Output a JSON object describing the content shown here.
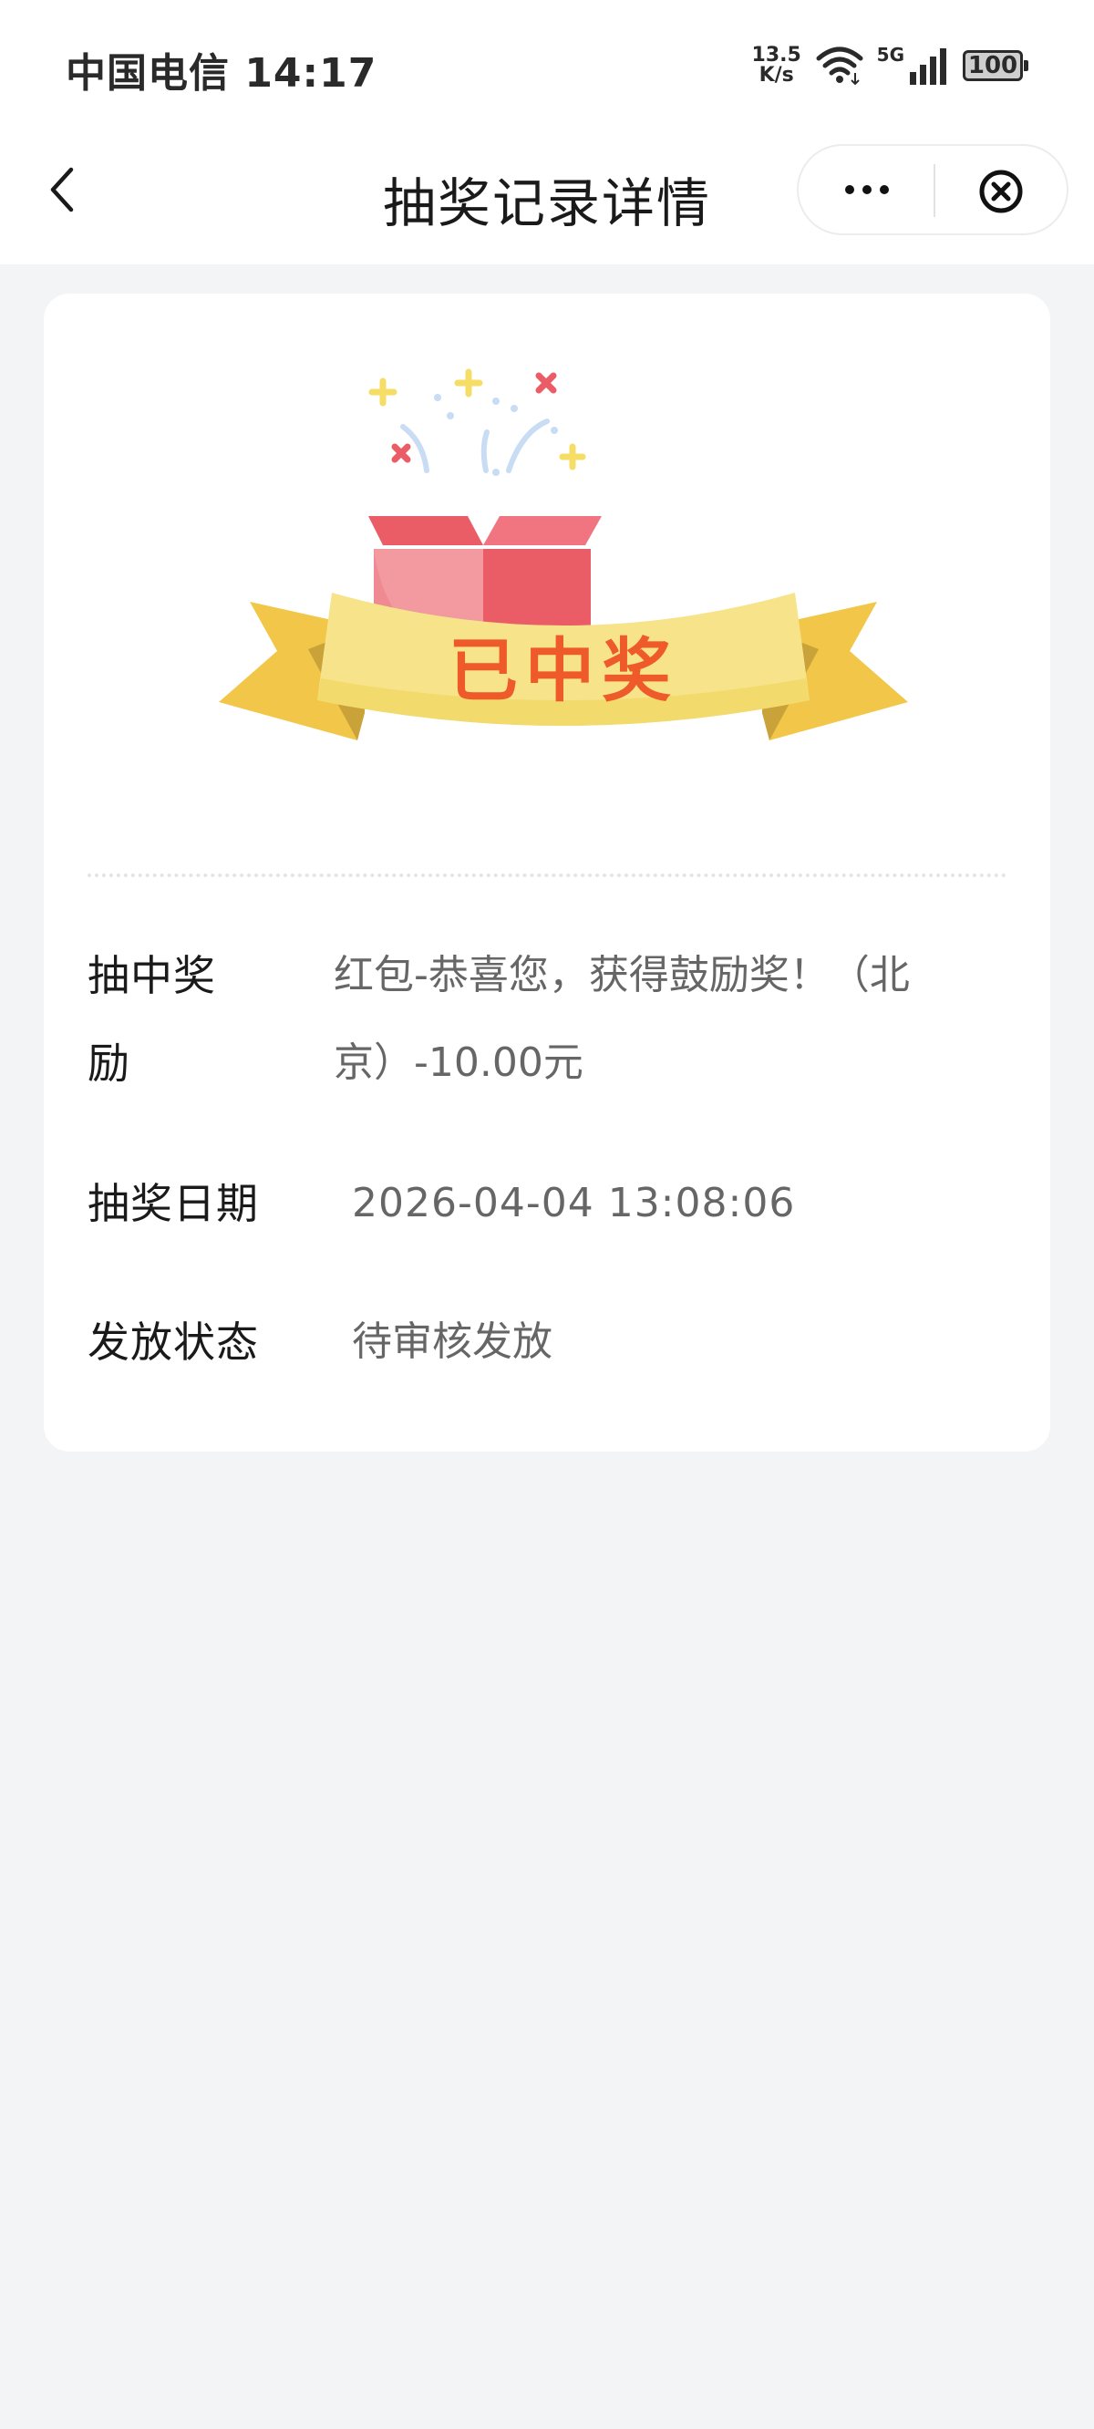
{
  "status_bar": {
    "carrier_time": "中国电信 14:17",
    "net_speed_value": "13.5",
    "net_speed_unit": "K/s",
    "network_gen": "5G",
    "battery": "100"
  },
  "nav": {
    "title": "抽奖记录详情"
  },
  "banner": {
    "text": "已中奖"
  },
  "details": {
    "prize_label": "抽中奖励",
    "prize_value": "红包-恭喜您，获得鼓励奖！（北京）-10.00元",
    "date_label": "抽奖日期",
    "date_value": "2026-04-04 13:08:06",
    "status_label": "发放状态",
    "status_value": "待审核发放"
  },
  "colors": {
    "accent": "#ef5a2a",
    "box_red": "#ea5d66",
    "ribbon_yellow": "#f7e48a",
    "ribbon_gold": "#f2c648",
    "background": "#f3f4f6"
  }
}
